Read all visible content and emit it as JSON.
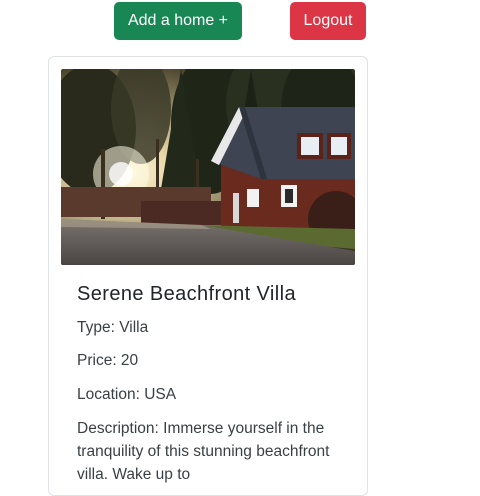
{
  "header": {
    "add_home_label": "Add a home +",
    "logout_label": "Logout",
    "add_color": "#198754",
    "logout_color": "#dc3545"
  },
  "home_card": {
    "title": "Serene Beachfront Villa",
    "type": "Type: Villa",
    "price": "Price: 20",
    "location": "Location: USA",
    "description": "Description: Immerse yourself in the tranquility of this stunning beachfront villa. Wake up to"
  }
}
